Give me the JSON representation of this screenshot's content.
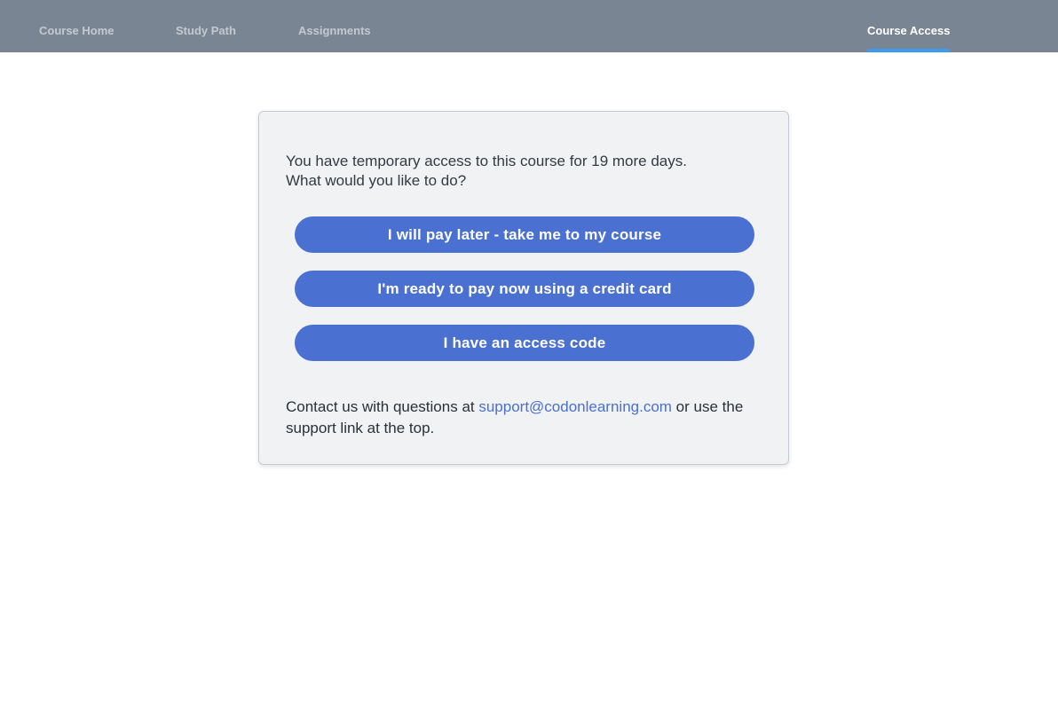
{
  "nav": {
    "tabs": [
      {
        "label": "Course Home",
        "active": false
      },
      {
        "label": "Study Path",
        "active": false
      },
      {
        "label": "Assignments",
        "active": false
      },
      {
        "label": "Course Access",
        "active": true
      }
    ]
  },
  "card": {
    "intro_line1": "You have temporary access to this course for 19 more days.",
    "intro_line2": "What would you like to do?",
    "buttons": {
      "pay_later": "I will pay later - take me to my course",
      "pay_now": "I'm ready to pay now using a credit card",
      "access_code": "I have an access code"
    },
    "contact": {
      "prefix": "Contact us with questions at ",
      "email": "support@codonlearning.com",
      "suffix": " or use the support link at the top."
    }
  },
  "colors": {
    "nav_bg": "#7a8593",
    "active_underline": "#3b9cf1",
    "button_bg": "#4a70d2",
    "link": "#4a6fcf",
    "card_bg": "#f1f2f4"
  }
}
